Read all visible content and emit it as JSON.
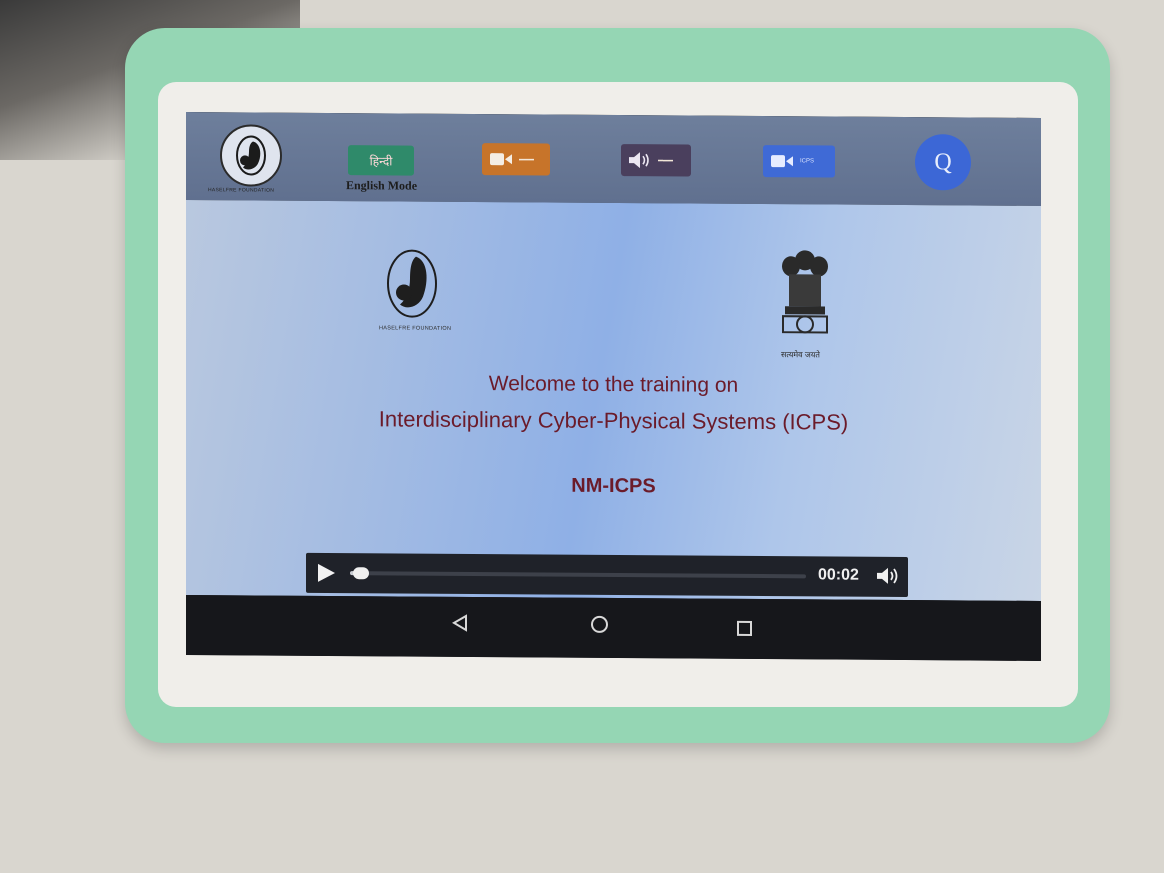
{
  "colors": {
    "case": "#95d6b4",
    "top_bar": "#6e7f9c",
    "heading_text": "#6b1b2a",
    "video_button": "#c7742a",
    "audio_button": "#4a3f5d",
    "icps_button": "#3f6ad6",
    "quiz_button": "#3c67d6"
  },
  "top_bar": {
    "org_logo_caption": "HASELFRE FOUNDATION",
    "hindi_button_label": "हिन्दी",
    "mode_label": "English Mode",
    "video_button_icon": "video-camera-icon",
    "audio_button_icon": "speaker-icon",
    "icps_button_icon": "video-camera-icon",
    "icps_button_label": "ICPS",
    "quiz_button_label": "Q"
  },
  "content": {
    "left_logo_caption": "HASELFRE FOUNDATION",
    "emblem_caption": "सत्यमेव जयते",
    "welcome_line": "Welcome to the training on",
    "subtitle_line": "Interdisciplinary Cyber-Physical Systems (ICPS)",
    "program_line": "NM-ICPS"
  },
  "player": {
    "current_time": "00:02",
    "progress_fraction": 0.01,
    "play_icon": "play-icon",
    "volume_icon": "volume-icon"
  },
  "nav": {
    "back_icon": "back-triangle-icon",
    "home_icon": "home-circle-icon",
    "recent_icon": "recent-square-icon"
  }
}
